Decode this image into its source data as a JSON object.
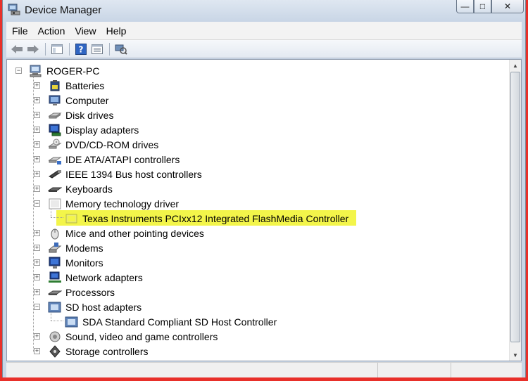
{
  "window": {
    "title": "Device Manager"
  },
  "caption_buttons": {
    "minimize": "—",
    "maximize": "□",
    "close": "✕"
  },
  "menu": [
    "File",
    "Action",
    "View",
    "Help"
  ],
  "toolbar_icons": [
    "back-arrow-icon",
    "forward-arrow-icon",
    "console-tree-icon",
    "help-icon",
    "properties-icon",
    "scan-hardware-icon"
  ],
  "tree": {
    "root": "ROGER-PC",
    "categories": [
      {
        "label": "Batteries",
        "expanded": false
      },
      {
        "label": "Computer",
        "expanded": false
      },
      {
        "label": "Disk drives",
        "expanded": false
      },
      {
        "label": "Display adapters",
        "expanded": false
      },
      {
        "label": "DVD/CD-ROM drives",
        "expanded": false
      },
      {
        "label": "IDE ATA/ATAPI controllers",
        "expanded": false
      },
      {
        "label": "IEEE 1394 Bus host controllers",
        "expanded": false
      },
      {
        "label": "Keyboards",
        "expanded": false
      },
      {
        "label": "Memory technology driver",
        "expanded": true,
        "children": [
          "Texas Instruments PCIxx12 Integrated FlashMedia Controller"
        ]
      },
      {
        "label": "Mice and other pointing devices",
        "expanded": false
      },
      {
        "label": "Modems",
        "expanded": false
      },
      {
        "label": "Monitors",
        "expanded": false
      },
      {
        "label": "Network adapters",
        "expanded": false
      },
      {
        "label": "Processors",
        "expanded": false
      },
      {
        "label": "SD host adapters",
        "expanded": true,
        "children": [
          "SDA Standard Compliant SD Host Controller"
        ]
      },
      {
        "label": "Sound, video and game controllers",
        "expanded": false
      },
      {
        "label": "Storage controllers",
        "expanded": false
      }
    ]
  },
  "colors": {
    "highlight": "#f3f54a",
    "frame": "#e8302a"
  }
}
